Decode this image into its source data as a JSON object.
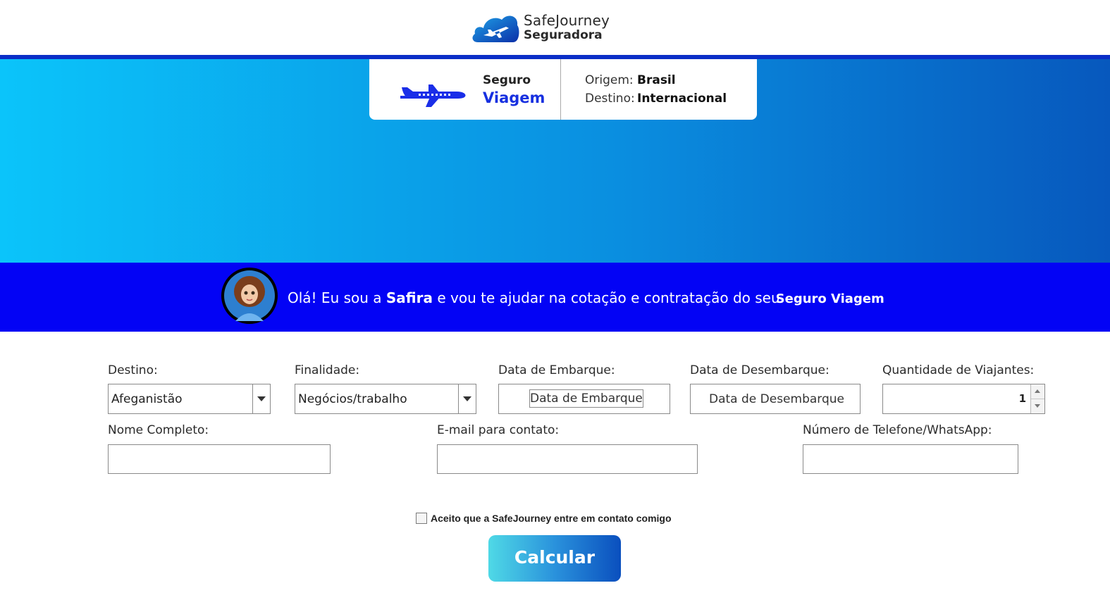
{
  "brand": {
    "name": "SafeJourney",
    "subtitle": "Seguradora"
  },
  "product_card": {
    "line1": "Seguro",
    "line2": "Viagem",
    "origin_label": "Origem:",
    "origin_value": "Brasil",
    "destination_label": "Destino:",
    "destination_value": "Internacional"
  },
  "assistant": {
    "greeting": "Olá! Eu sou a ",
    "name": "Safira",
    "message": " e vou te ajudar na cotação e contratação do seu",
    "product": "Seguro Viagem"
  },
  "form": {
    "destination": {
      "label": "Destino:",
      "value": "Afeganistão"
    },
    "purpose": {
      "label": "Finalidade:",
      "value": "Negócios/trabalho"
    },
    "departure": {
      "label": "Data de Embarque:",
      "value": "Data de Embarque"
    },
    "return": {
      "label": "Data de Desembarque:",
      "value": "Data de Desembarque"
    },
    "travelers": {
      "label": "Quantidade de Viajantes:",
      "value": "1"
    },
    "full_name": {
      "label": "Nome Completo:",
      "value": ""
    },
    "email": {
      "label": "E-mail para contato:",
      "value": ""
    },
    "phone": {
      "label": "Número de Telefone/WhatsApp:",
      "value": ""
    },
    "consent_label": "Aceito que a SafeJourney entre em contato comigo",
    "consent_checked": false,
    "submit_label": "Calcular"
  },
  "colors": {
    "accent_blue": "#0303f5",
    "top_line": "#0a2ec7",
    "hero_start": "#0bc4fa",
    "hero_end": "#0758bd",
    "viagem_text": "#1730e0"
  }
}
